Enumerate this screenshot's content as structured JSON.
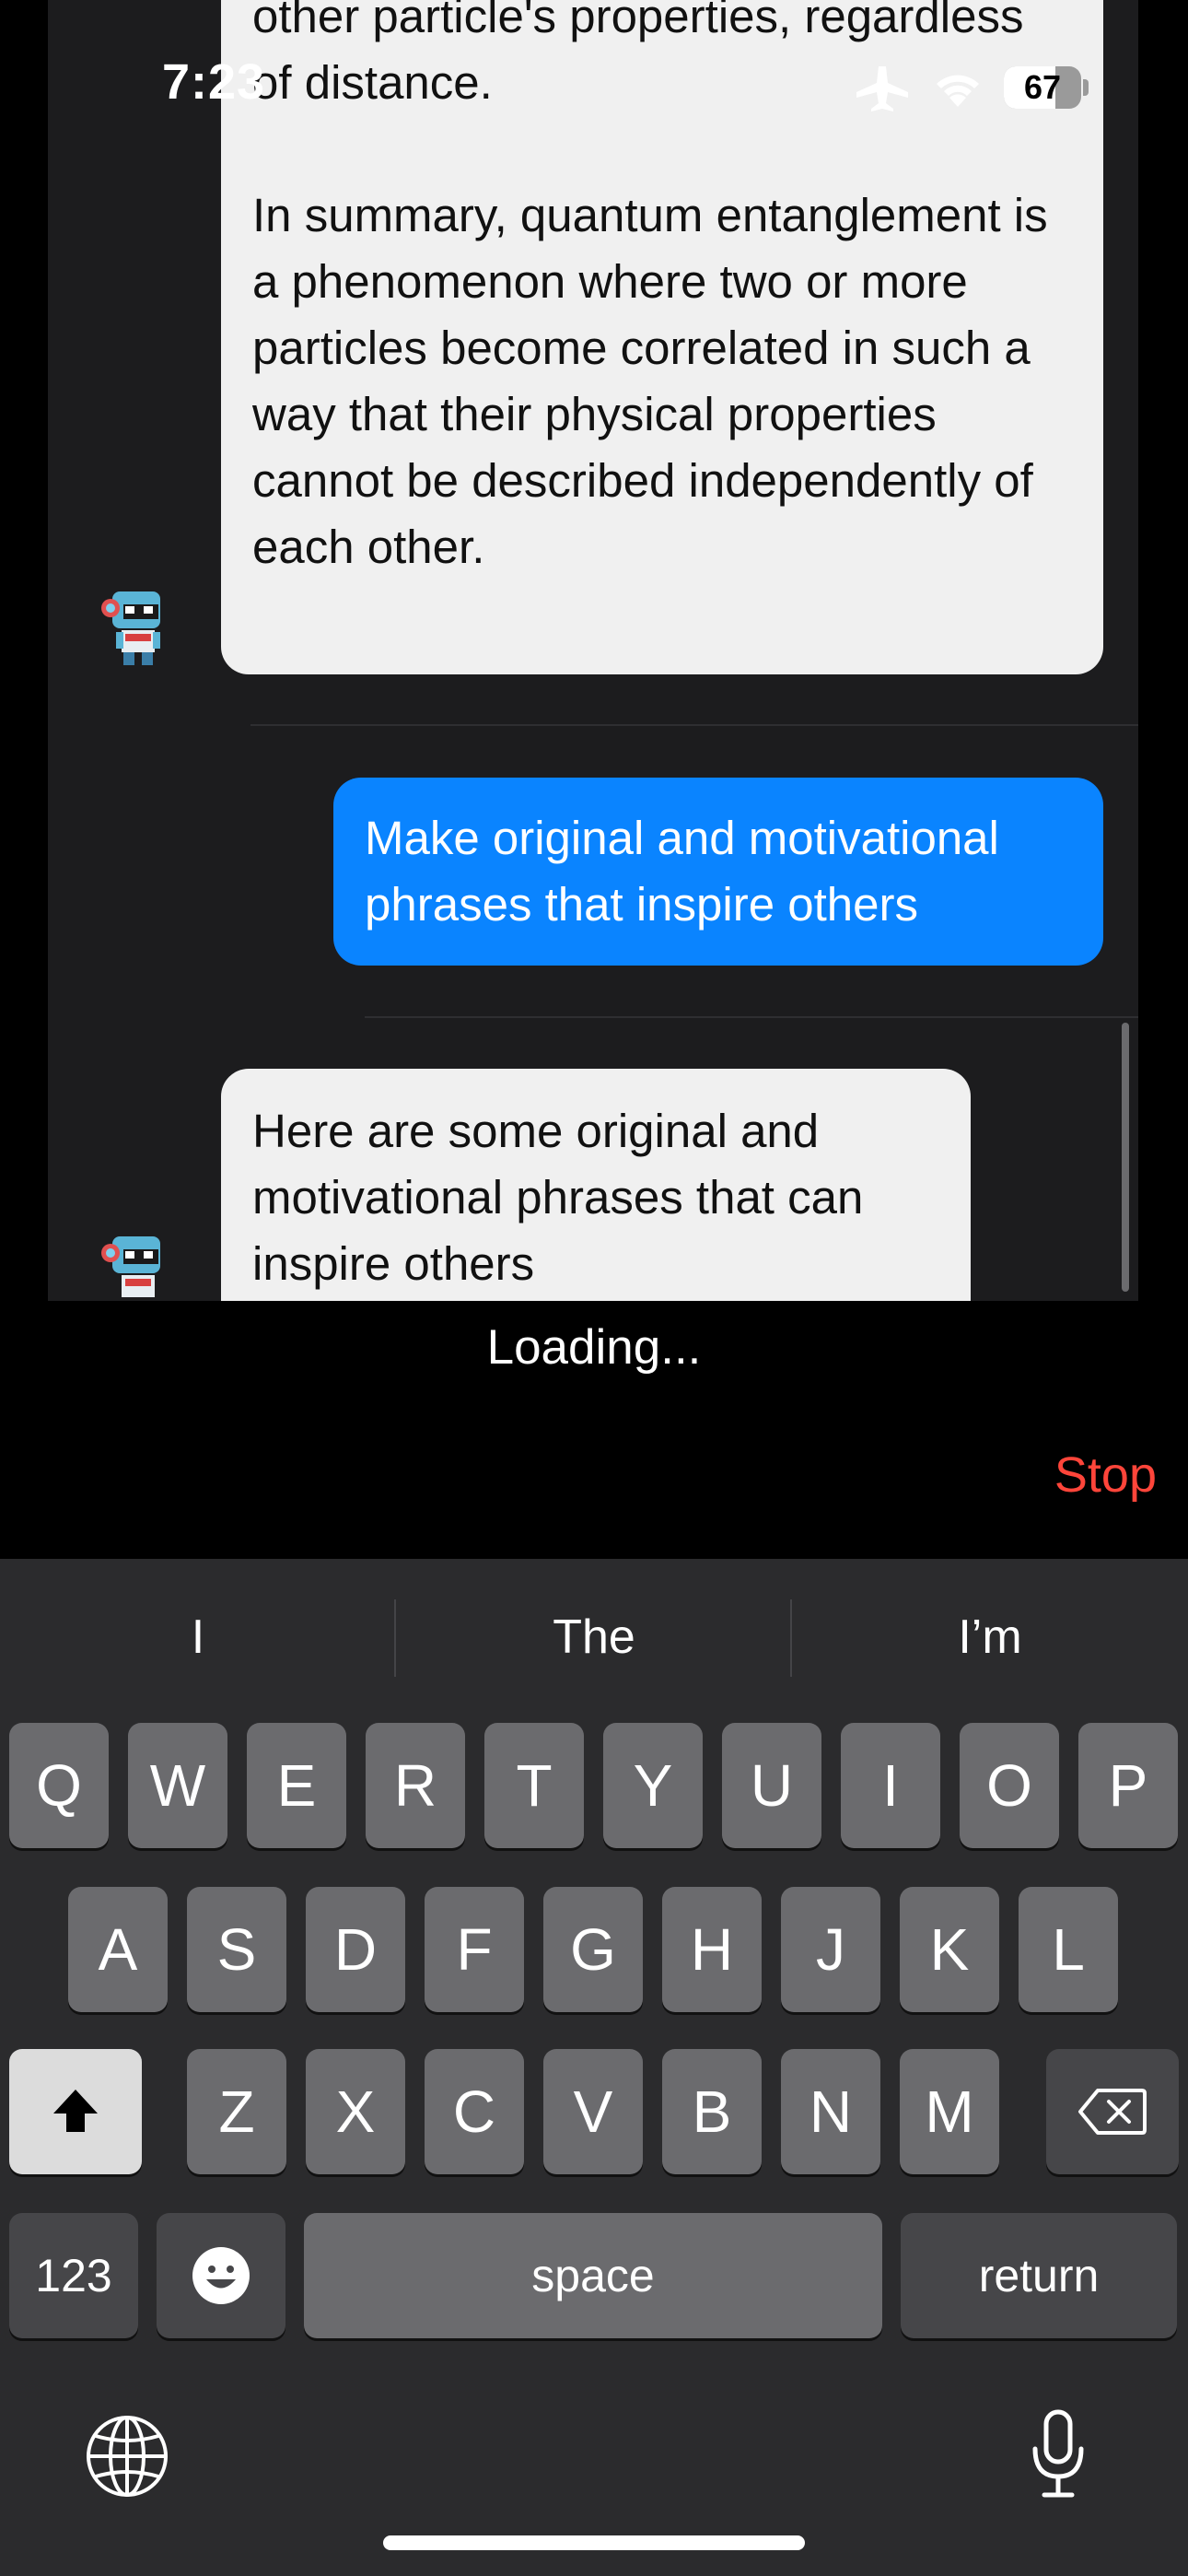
{
  "status_bar": {
    "time": "7:23",
    "battery": "67",
    "battery_level": 0.67,
    "icons": [
      "airplane-icon",
      "wifi-icon",
      "battery-icon"
    ]
  },
  "chat": {
    "messages": [
      {
        "role": "assistant",
        "paragraphs": [
          "other particle's properties, regardless of distance.",
          "In summary, quantum entanglement is a phenomenon where two or more particles become correlated in such a way that their physical properties cannot be described independently of each other."
        ]
      },
      {
        "role": "user",
        "text": "Make original and motivational phrases that inspire others"
      },
      {
        "role": "assistant",
        "text": "Here are some original and motivational phrases that can inspire others"
      }
    ]
  },
  "loading_text": "Loading...",
  "stop_label": "Stop",
  "keyboard": {
    "suggestions": [
      "I",
      "The",
      "I’m"
    ],
    "row1": [
      "Q",
      "W",
      "E",
      "R",
      "T",
      "Y",
      "U",
      "I",
      "O",
      "P"
    ],
    "row2": [
      "A",
      "S",
      "D",
      "F",
      "G",
      "H",
      "J",
      "K",
      "L"
    ],
    "row3": [
      "Z",
      "X",
      "C",
      "V",
      "B",
      "N",
      "M"
    ],
    "numbers_label": "123",
    "space_label": "space",
    "return_label": "return"
  },
  "colors": {
    "accent": "#0a84ff",
    "stop": "#ff453a",
    "chat_bg": "#1c1c1e",
    "bot_bubble": "#f0f0f0"
  }
}
